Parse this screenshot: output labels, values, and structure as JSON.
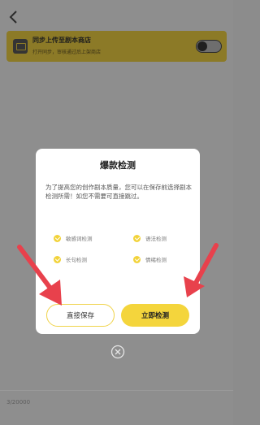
{
  "header": {
    "back_icon": "chevron-left-icon"
  },
  "banner": {
    "title": "同步上传至剧本商店",
    "subtitle": "打开同步，审核通过后上架商店",
    "toggle_on": false
  },
  "editor": {
    "counter": "3/20000"
  },
  "dialog": {
    "title": "爆款检测",
    "description": "为了提高您的创作剧本质量，您可以在保存前选择剧本检测所需！如您不需要可直接跳过。",
    "checks": [
      {
        "label": "敏感词检测",
        "checked": true
      },
      {
        "label": "语法检测",
        "checked": true
      },
      {
        "label": "长句检测",
        "checked": true
      },
      {
        "label": "情绪检测",
        "checked": true
      }
    ],
    "save_button": "直接保存",
    "check_button": "立即检测"
  },
  "colors": {
    "accent": "#f4d53c",
    "arrow": "#e8414c",
    "overlay": "#8e8e8e"
  }
}
